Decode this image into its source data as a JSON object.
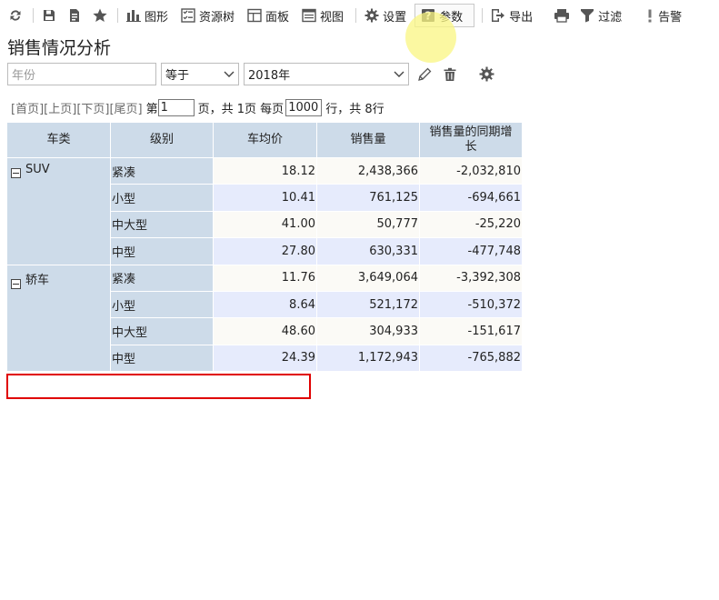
{
  "toolbar": {
    "items": [
      {
        "label": "图形"
      },
      {
        "label": "资源树"
      },
      {
        "label": "面板"
      },
      {
        "label": "视图"
      },
      {
        "label": "设置"
      },
      {
        "label": "参数"
      },
      {
        "label": "导出"
      },
      {
        "label": "过滤"
      },
      {
        "label": "告警"
      }
    ]
  },
  "page": {
    "title": "销售情况分析"
  },
  "filter": {
    "field_placeholder": "年份",
    "operator": "等于",
    "value": "2018年"
  },
  "pager": {
    "first": "[首页]",
    "prev": "[上页]",
    "next": "[下页]",
    "last": "[尾页]",
    "page_prefix": "第",
    "current_page": "1",
    "page_suffix": "页，共 1页 每页",
    "page_size": "1000",
    "rows_suffix": "行，共 8行"
  },
  "table": {
    "headers": [
      "车类",
      "级别",
      "车均价",
      "销售量",
      "销售量的同期增长"
    ],
    "groups": [
      {
        "name": "SUV",
        "rows": [
          {
            "level": "紧凑",
            "avg_price": "18.12",
            "sales": "2,438,366",
            "yoy": "-2,032,810"
          },
          {
            "level": "小型",
            "avg_price": "10.41",
            "sales": "761,125",
            "yoy": "-694,661"
          },
          {
            "level": "中大型",
            "avg_price": "41.00",
            "sales": "50,777",
            "yoy": "-25,220"
          },
          {
            "level": "中型",
            "avg_price": "27.80",
            "sales": "630,331",
            "yoy": "-477,748"
          }
        ]
      },
      {
        "name": "轿车",
        "rows": [
          {
            "level": "紧凑",
            "avg_price": "11.76",
            "sales": "3,649,064",
            "yoy": "-3,392,308"
          },
          {
            "level": "小型",
            "avg_price": "8.64",
            "sales": "521,172",
            "yoy": "-510,372"
          },
          {
            "level": "中大型",
            "avg_price": "48.60",
            "sales": "304,933",
            "yoy": "-151,617"
          },
          {
            "level": "中型",
            "avg_price": "24.39",
            "sales": "1,172,943",
            "yoy": "-765,882"
          }
        ]
      }
    ]
  },
  "colors": {
    "header_bg": "#cddbe9",
    "row_odd": "#fbfaf6",
    "row_even": "#e6ebfc",
    "highlight_box": "#e00000"
  }
}
